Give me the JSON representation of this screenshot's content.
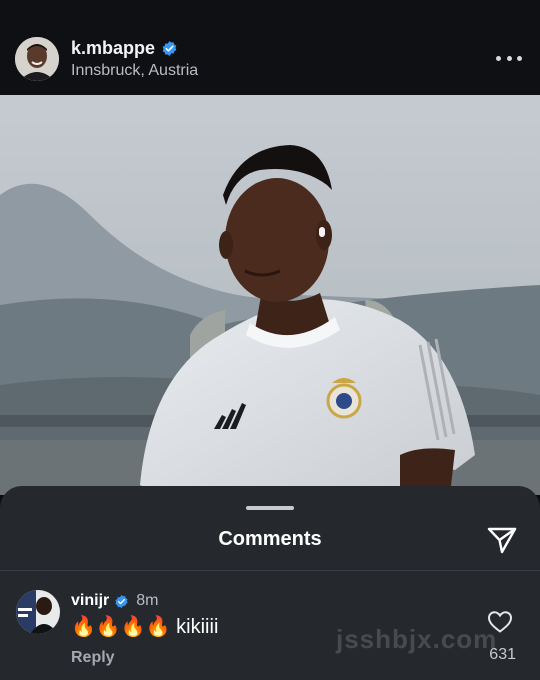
{
  "post": {
    "username": "k.mbappe",
    "location": "Innsbruck, Austria"
  },
  "comments_sheet": {
    "title": "Comments"
  },
  "comment": {
    "username": "vinijr",
    "time": "8m",
    "text": "🔥🔥🔥🔥 kikiiii",
    "reply_label": "Reply",
    "like_count": "631"
  },
  "watermark": "jsshbjx.com",
  "colors": {
    "header_bg": "#0e1014",
    "sheet_bg": "#25282d",
    "verified_blue": "#3797f0",
    "muted_text": "#b9bcc2"
  },
  "icons": [
    "verified-badge-icon",
    "more-options-icon",
    "share-icon",
    "heart-icon",
    "grabber-handle"
  ]
}
